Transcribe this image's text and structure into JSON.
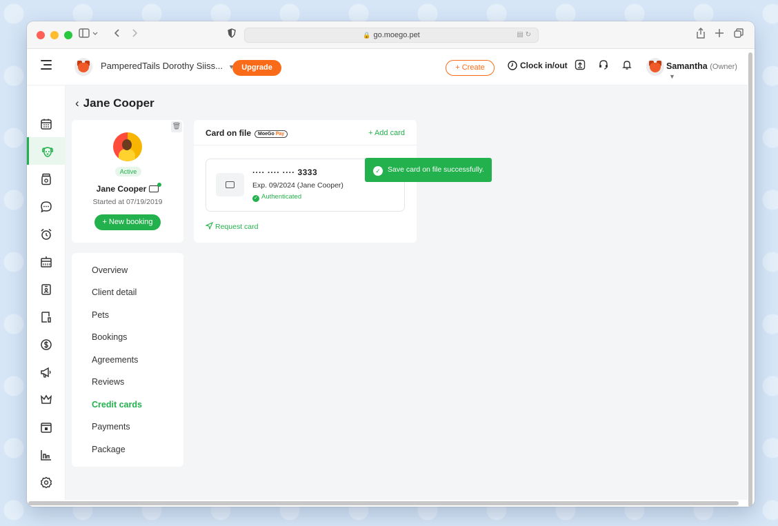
{
  "browser": {
    "url": "go.moego.pet"
  },
  "header": {
    "business_name": "PamperedTails Dorothy Siiss...",
    "upgrade_label": "Upgrade",
    "create_label": "+ Create",
    "clock_label": "Clock in/out",
    "user_name": "Samantha",
    "user_role": "(Owner)"
  },
  "toast": {
    "message": "Save card on file successfully."
  },
  "page": {
    "back_title": "Jane Cooper"
  },
  "profile": {
    "status": "Active",
    "name": "Jane Cooper",
    "started": "Started at 07/19/2019",
    "new_booking_label": "+ New booking"
  },
  "nav": {
    "items": [
      {
        "label": "Overview"
      },
      {
        "label": "Client detail"
      },
      {
        "label": "Pets"
      },
      {
        "label": "Bookings"
      },
      {
        "label": "Agreements"
      },
      {
        "label": "Reviews"
      },
      {
        "label": "Credit cards"
      },
      {
        "label": "Payments"
      },
      {
        "label": "Package"
      }
    ],
    "active": "Credit cards"
  },
  "card_on_file": {
    "title": "Card on file",
    "badge_moego": "MoeGo",
    "badge_pay": "Pay",
    "add_card_label": "+ Add card",
    "card_number": "···· ···· ···· 3333",
    "expiry": "Exp. 09/2024  (Jane Cooper)",
    "auth_status": "Authenticated",
    "request_card_label": "Request card"
  },
  "sidebar": {
    "items": [
      {
        "icon": "calendar-icon"
      },
      {
        "icon": "dog-face-icon"
      },
      {
        "icon": "pet-food-icon"
      },
      {
        "icon": "chat-bubble-icon"
      },
      {
        "icon": "alarm-clock-icon"
      },
      {
        "icon": "calendar-grid-icon"
      },
      {
        "icon": "id-badge-icon"
      },
      {
        "icon": "document-icon"
      },
      {
        "icon": "dollar-icon"
      },
      {
        "icon": "megaphone-icon"
      },
      {
        "icon": "crown-icon"
      },
      {
        "icon": "card-stack-icon"
      },
      {
        "icon": "bar-chart-icon"
      },
      {
        "icon": "gear-icon"
      }
    ],
    "active_index": 1
  },
  "colors": {
    "accent_green": "#22b14c",
    "accent_orange": "#f96b18"
  }
}
